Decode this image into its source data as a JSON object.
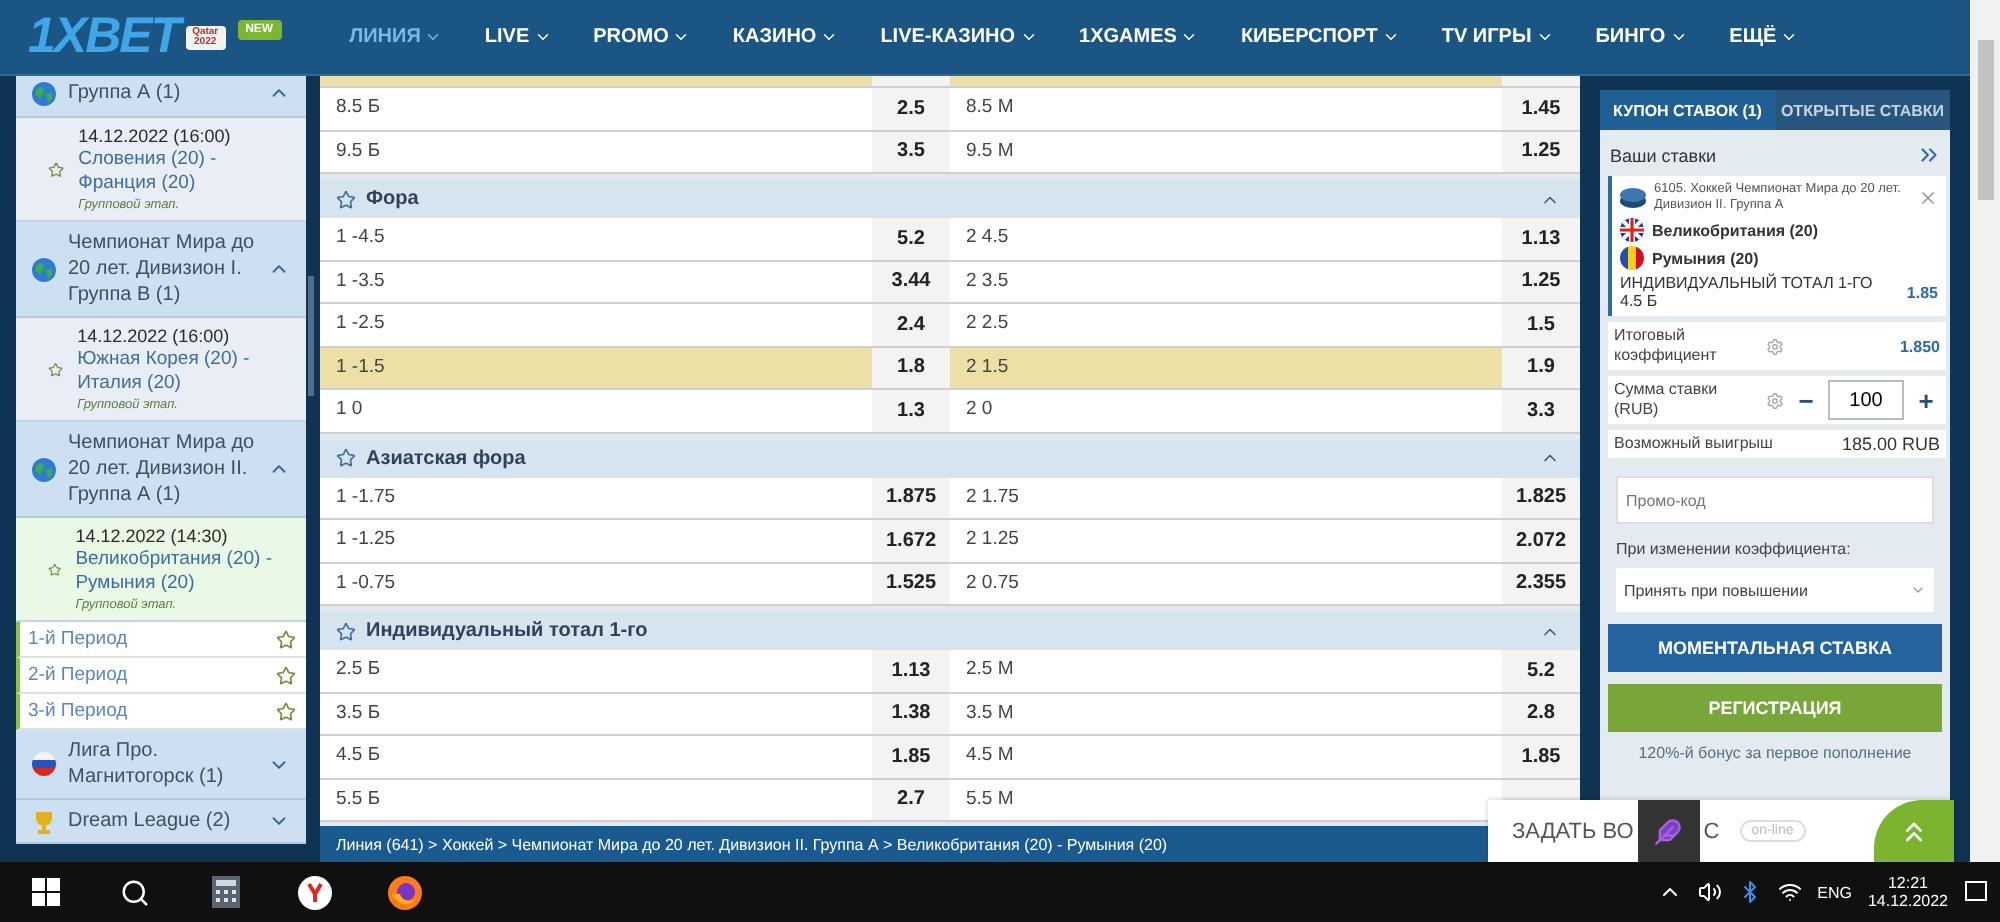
{
  "header": {
    "logo": "1XBET",
    "promo_badge": "Qatar 2022",
    "new_badge": "NEW",
    "nav": [
      {
        "label": "ЛИНИЯ",
        "selected": true
      },
      {
        "label": "LIVE",
        "selected": false
      },
      {
        "label": "PROMO",
        "selected": false
      },
      {
        "label": "КАЗИНО",
        "selected": false
      },
      {
        "label": "LIVE-КАЗИНО",
        "selected": false
      },
      {
        "label": "1XGAMES",
        "selected": false
      },
      {
        "label": "КИБЕРСПОРТ",
        "selected": false
      },
      {
        "label": "TV ИГРЫ",
        "selected": false
      },
      {
        "label": "БИНГО",
        "selected": false
      },
      {
        "label": "ЕЩЁ",
        "selected": false
      }
    ]
  },
  "sidebar": {
    "items": [
      {
        "kind": "league",
        "title": "Группа А (1)",
        "expanded": true
      },
      {
        "kind": "match",
        "date": "14.12.2022 (16:00)",
        "teams": "Словения (20) - Франция (20)",
        "stage": "Групповой этап.",
        "selected": false
      },
      {
        "kind": "league",
        "title": "Чемпионат Мира до 20 лет. Дивизион I. Группа B (1)",
        "expanded": true
      },
      {
        "kind": "match",
        "date": "14.12.2022 (16:00)",
        "teams": "Южная Корея (20) - Италия (20)",
        "stage": "Групповой этап.",
        "selected": false
      },
      {
        "kind": "league",
        "title": "Чемпионат Мира до 20 лет. Дивизион II. Группа А (1)",
        "expanded": true
      },
      {
        "kind": "match",
        "date": "14.12.2022 (14:30)",
        "teams": "Великобритания (20) - Румыния (20)",
        "stage": "Групповой этап.",
        "selected": true
      },
      {
        "kind": "period",
        "title": "1-й Период"
      },
      {
        "kind": "period",
        "title": "2-й Период"
      },
      {
        "kind": "period",
        "title": "3-й Период"
      },
      {
        "kind": "national",
        "title": "Лига Про. Магнитогорск (1)",
        "expanded": false
      },
      {
        "kind": "cup",
        "title": "Dream League (2)",
        "expanded": false
      }
    ]
  },
  "markets": [
    {
      "rows": [
        {
          "selected": true
        },
        {
          "label_1": "8.5 Б",
          "odds_1": "2.5",
          "label_2": "8.5 М",
          "odds_2": "1.45",
          "selected": false
        },
        {
          "label_1": "9.5 Б",
          "odds_1": "3.5",
          "label_2": "9.5 М",
          "odds_2": "1.25",
          "selected": false
        }
      ]
    },
    {
      "title": "Фора",
      "expanded": true,
      "rows": [
        {
          "label_1": "1 -4.5",
          "odds_1": "5.2",
          "label_2": "2 4.5",
          "odds_2": "1.13",
          "selected": false
        },
        {
          "label_1": "1 -3.5",
          "odds_1": "3.44",
          "label_2": "2 3.5",
          "odds_2": "1.25",
          "selected": false
        },
        {
          "label_1": "1 -2.5",
          "odds_1": "2.4",
          "label_2": "2 2.5",
          "odds_2": "1.5",
          "selected": false
        },
        {
          "label_1": "1 -1.5",
          "odds_1": "1.8",
          "label_2": "2 1.5",
          "odds_2": "1.9",
          "selected": true
        },
        {
          "label_1": "1 0",
          "odds_1": "1.3",
          "label_2": "2 0",
          "odds_2": "3.3",
          "selected": false
        }
      ]
    },
    {
      "title": "Азиатская фора",
      "expanded": true,
      "rows": [
        {
          "label_1": "1 -1.75",
          "odds_1": "1.875",
          "label_2": "2 1.75",
          "odds_2": "1.825",
          "selected": false
        },
        {
          "label_1": "1 -1.25",
          "odds_1": "1.672",
          "label_2": "2 1.25",
          "odds_2": "2.072",
          "selected": false
        },
        {
          "label_1": "1 -0.75",
          "odds_1": "1.525",
          "label_2": "2 0.75",
          "odds_2": "2.355",
          "selected": false
        }
      ]
    },
    {
      "title": "Индивидуальный тотал 1-го",
      "expanded": true,
      "rows": [
        {
          "label_1": "2.5 Б",
          "odds_1": "1.13",
          "label_2": "2.5 М",
          "odds_2": "5.2",
          "selected": false
        },
        {
          "label_1": "3.5 Б",
          "odds_1": "1.38",
          "label_2": "3.5 М",
          "odds_2": "2.8",
          "selected": false
        },
        {
          "label_1": "4.5 Б",
          "odds_1": "1.85",
          "label_2": "4.5 М",
          "odds_2": "1.85",
          "selected": false
        },
        {
          "label_1": "5.5 Б",
          "odds_1": "2.7",
          "label_2": "5.5 М",
          "selected": false
        }
      ]
    }
  ],
  "breadcrumb": "Линия (641) > Хоккей > Чемпионат Мира до 20 лет. Дивизион II. Группа А > Великобритания (20) - Румыния (20)",
  "coupon": {
    "tabs": [
      {
        "label": "КУПОН СТАВОК (1)",
        "selected": true
      },
      {
        "label": "ОТКРЫТЫЕ СТАВКИ",
        "selected": false
      }
    ],
    "heading": "Ваши ставки",
    "bet": {
      "event": "6105. Хоккей Чемпионат Мира до 20 лет. Дивизион II. Группа А",
      "team_1": "Великобритания (20)",
      "team_2": "Румыния (20)",
      "market": "ИНДИВИДУАЛЬНЫЙ ТОТАЛ 1-ГО 4.5 Б",
      "odds": "1.85"
    },
    "total_label": "Итоговый коэффициент",
    "total_value": "1.850",
    "stake_label": "Сумма ставки (RUB)",
    "minus": "−",
    "stake": "100",
    "plus": "+",
    "win_label": "Возможный выигрыш",
    "win_value": "185.00 RUB",
    "promo": {
      "placeholder": "Промо-код"
    },
    "change_label": "При изменении коэффициента:",
    "change_value": "Принять при повышении",
    "instant_button": "МОМЕНТАЛЬНАЯ СТАВКА",
    "register_button": "РЕГИСТРАЦИЯ",
    "bonus": "120%-й бонус за первое пополнение"
  },
  "chat": {
    "text_left": "ЗАДАТЬ ВО",
    "text_right": "С",
    "status": "on-line"
  },
  "taskbar": {
    "language": "ENG",
    "time": "12:21",
    "date": "14.12.2022"
  }
}
